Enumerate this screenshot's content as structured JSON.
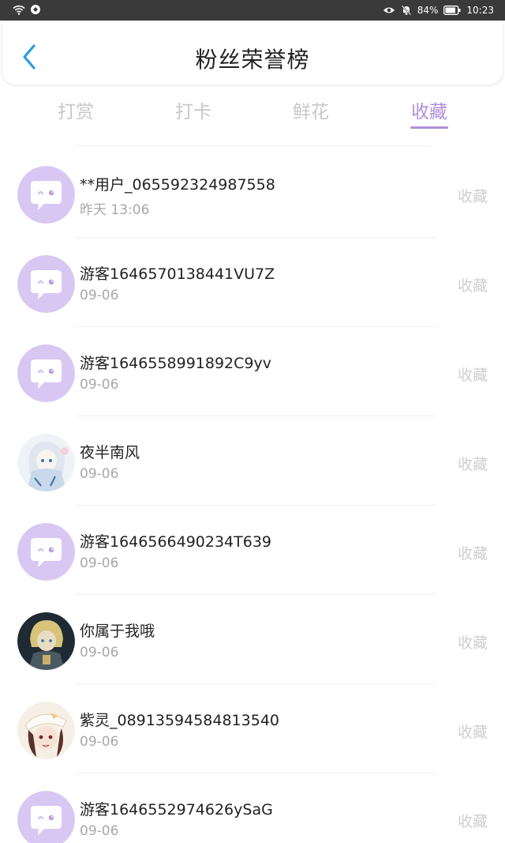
{
  "status_bar": {
    "battery": "84%",
    "time": "10:23"
  },
  "header": {
    "title": "粉丝荣誉榜"
  },
  "tabs": [
    {
      "label": "打赏"
    },
    {
      "label": "打卡"
    },
    {
      "label": "鲜花"
    },
    {
      "label": "收藏"
    }
  ],
  "active_tab": "收藏",
  "colors": {
    "accent": "#b08fd8",
    "default_avatar": "#d9c7f3"
  },
  "fans": [
    {
      "name": "**用户_065592324987558",
      "time": "昨天 13:06",
      "action": "收藏",
      "avatar": "default-chat-avatar"
    },
    {
      "name": "游客1646570138441VU7Z",
      "time": "09-06",
      "action": "收藏",
      "avatar": "default-chat-avatar"
    },
    {
      "name": "游客1646558991892C9yv",
      "time": "09-06",
      "action": "收藏",
      "avatar": "default-chat-avatar"
    },
    {
      "name": "夜半南风",
      "time": "09-06",
      "action": "收藏",
      "avatar": "anime-girl-blue-avatar"
    },
    {
      "name": "游客1646566490234T639",
      "time": "09-06",
      "action": "收藏",
      "avatar": "default-chat-avatar"
    },
    {
      "name": "你属于我哦",
      "time": "09-06",
      "action": "收藏",
      "avatar": "blonde-character-dark-avatar"
    },
    {
      "name": "紫灵_08913594584813540",
      "time": "09-06",
      "action": "收藏",
      "avatar": "anime-girl-hat-avatar"
    },
    {
      "name": "游客1646552974626ySaG",
      "time": "09-06",
      "action": "收藏",
      "avatar": "default-chat-avatar"
    }
  ]
}
